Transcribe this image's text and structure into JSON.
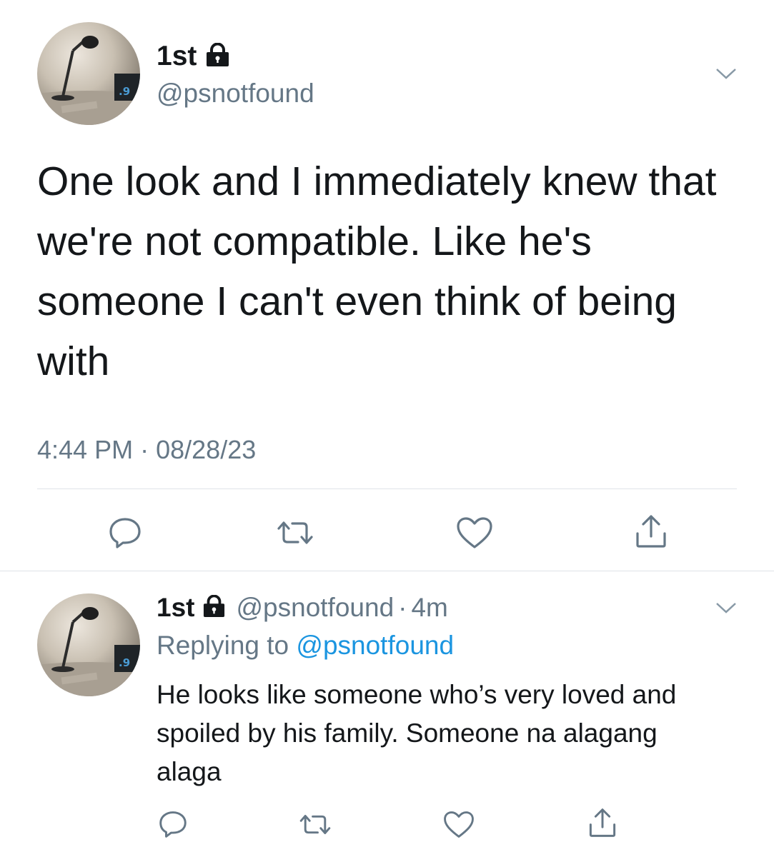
{
  "main_tweet": {
    "display_name": "1st",
    "handle": "@psnotfound",
    "protected_icon": "lock-icon",
    "text": "One look and I immediately knew that we're not compatible. Like he's someone I can't even think of being with",
    "time": "4:44 PM",
    "separator": "·",
    "date": "08/28/23",
    "actions": [
      "reply-icon",
      "retweet-icon",
      "like-icon",
      "share-icon"
    ]
  },
  "reply_tweet": {
    "display_name": "1st",
    "handle": "@psnotfound",
    "separator": "·",
    "age": "4m",
    "replying_prefix": "Replying to",
    "replying_to": "@psnotfound",
    "text": "He looks like someone who’s very loved and spoiled by his family. Someone na alagang alaga",
    "actions": [
      "reply-icon",
      "retweet-icon",
      "like-icon",
      "share-icon"
    ]
  },
  "colors": {
    "text_primary": "#14171a",
    "text_secondary": "#657786",
    "link": "#1b95e0",
    "divider": "#dfe3e8"
  }
}
